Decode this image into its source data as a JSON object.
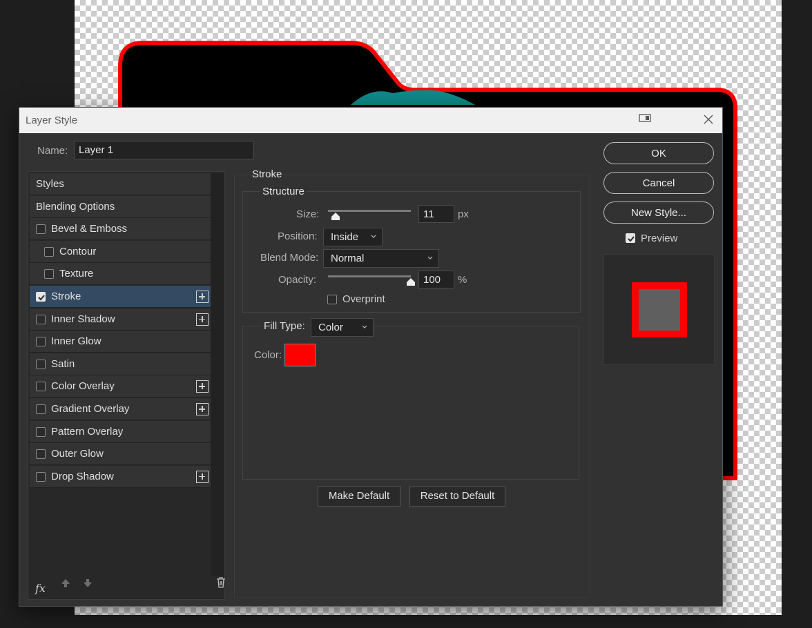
{
  "dialog": {
    "title": "Layer Style",
    "name_label": "Name:",
    "name_value": "Layer 1"
  },
  "styles_list": {
    "items": [
      {
        "label": "Styles",
        "has_checkbox": false,
        "checked": false,
        "has_add": false
      },
      {
        "label": "Blending Options",
        "has_checkbox": false,
        "checked": false,
        "has_add": false
      },
      {
        "label": "Bevel & Emboss",
        "has_checkbox": true,
        "checked": false,
        "has_add": false
      },
      {
        "label": "Contour",
        "has_checkbox": true,
        "checked": false,
        "has_add": false,
        "indent": true
      },
      {
        "label": "Texture",
        "has_checkbox": true,
        "checked": false,
        "has_add": false,
        "indent": true
      },
      {
        "label": "Stroke",
        "has_checkbox": true,
        "checked": true,
        "has_add": true,
        "selected": true
      },
      {
        "label": "Inner Shadow",
        "has_checkbox": true,
        "checked": false,
        "has_add": true
      },
      {
        "label": "Inner Glow",
        "has_checkbox": true,
        "checked": false,
        "has_add": false
      },
      {
        "label": "Satin",
        "has_checkbox": true,
        "checked": false,
        "has_add": false
      },
      {
        "label": "Color Overlay",
        "has_checkbox": true,
        "checked": false,
        "has_add": true
      },
      {
        "label": "Gradient Overlay",
        "has_checkbox": true,
        "checked": false,
        "has_add": true
      },
      {
        "label": "Pattern Overlay",
        "has_checkbox": true,
        "checked": false,
        "has_add": false
      },
      {
        "label": "Outer Glow",
        "has_checkbox": true,
        "checked": false,
        "has_add": false
      },
      {
        "label": "Drop Shadow",
        "has_checkbox": true,
        "checked": false,
        "has_add": true
      }
    ],
    "fx_label": "fx"
  },
  "stroke": {
    "heading": "Stroke",
    "structure_heading": "Structure",
    "size_label": "Size:",
    "size_value": "11",
    "size_unit": "px",
    "size_slider_fraction": 0.09,
    "position_label": "Position:",
    "position_value": "Inside",
    "blend_mode_label": "Blend Mode:",
    "blend_mode_value": "Normal",
    "opacity_label": "Opacity:",
    "opacity_value": "100",
    "opacity_unit": "%",
    "opacity_slider_fraction": 1.0,
    "overprint_label": "Overprint",
    "overprint_checked": false,
    "fill_type_label": "Fill Type:",
    "fill_type_value": "Color",
    "color_label": "Color:",
    "color_value": "#ff0000",
    "make_default_label": "Make Default",
    "reset_default_label": "Reset to Default"
  },
  "actions": {
    "ok_label": "OK",
    "cancel_label": "Cancel",
    "new_style_label": "New Style...",
    "preview_label": "Preview",
    "preview_checked": true
  },
  "colors": {
    "stroke_red": "#ff0000",
    "selected_row": "#344a62",
    "dialog_bg": "#323232"
  }
}
